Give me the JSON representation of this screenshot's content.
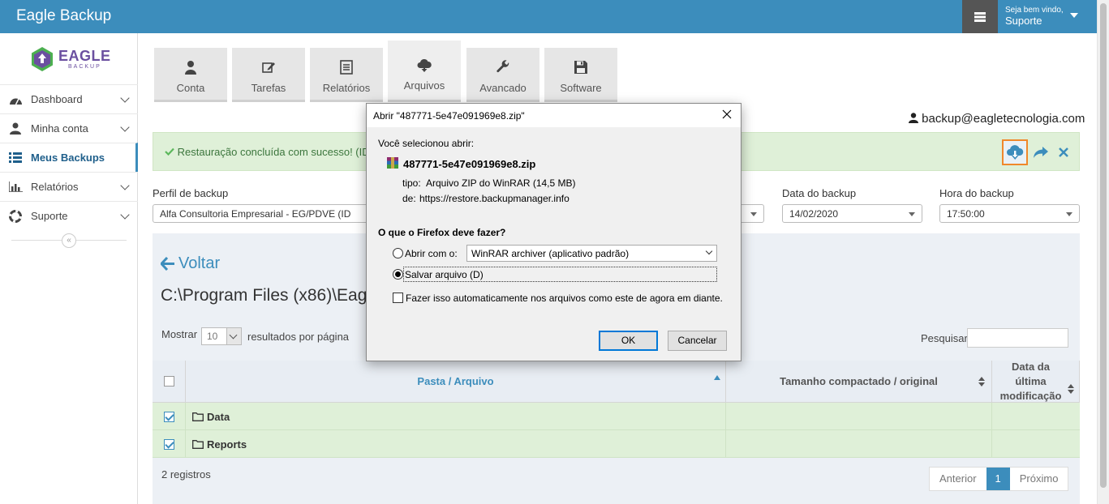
{
  "app": {
    "title": "Eagle Backup",
    "welcome": "Seja bem vindo,",
    "user_name": "Suporte"
  },
  "logo": {
    "text": "EAGLE",
    "sub": "BACKUP"
  },
  "sidebar": {
    "items": [
      {
        "label": "Dashboard",
        "icon": "dashboard-icon"
      },
      {
        "label": "Minha conta",
        "icon": "user-icon"
      },
      {
        "label": "Meus Backups",
        "icon": "list-icon",
        "active": true
      },
      {
        "label": "Relatórios",
        "icon": "bar-chart-icon"
      },
      {
        "label": "Suporte",
        "icon": "lifebuoy-icon"
      }
    ],
    "collapse_glyph": "«"
  },
  "tabs": [
    {
      "label": "Conta",
      "icon": "user-icon"
    },
    {
      "label": "Tarefas",
      "icon": "edit-icon"
    },
    {
      "label": "Relatórios",
      "icon": "report-icon"
    },
    {
      "label": "Arquivos",
      "icon": "cloud-download-icon",
      "active": true
    },
    {
      "label": "Avancado",
      "icon": "wrench-icon"
    },
    {
      "label": "Software",
      "icon": "floppy-icon"
    }
  ],
  "user_email": "backup@eagletecnologia.com",
  "alert": {
    "text": "Restauração concluída com sucesso! (ID",
    "color": "#3c763d"
  },
  "form": {
    "perfil_label": "Perfil de backup",
    "perfil_value": "Alfa Consultoria Empresarial - EG/PDVE (ID",
    "data_label": "Data do backup",
    "data_value": "14/02/2020",
    "hora_label": "Hora do backup",
    "hora_value": "17:50:00"
  },
  "content": {
    "back_label": "Voltar",
    "path": "C:\\Program Files (x86)\\Eagle",
    "show_label": "Mostrar",
    "page_size": "10",
    "show_suffix": "resultados por página",
    "search_label": "Pesquisar",
    "search_value": ""
  },
  "table": {
    "columns": [
      "Pasta / Arquivo",
      "Tamanho compactado / original",
      "Data da última modificação"
    ],
    "rows": [
      {
        "name": "Data",
        "checked": true,
        "size": "",
        "modified": ""
      },
      {
        "name": "Reports",
        "checked": true,
        "size": "",
        "modified": ""
      }
    ],
    "records": "2 registros"
  },
  "pager": {
    "prev": "Anterior",
    "current": "1",
    "next": "Próximo"
  },
  "dialog": {
    "title": "Abrir \"487771-5e47e091969e8.zip\"",
    "selected_label": "Você selecionou abrir:",
    "file_name": "487771-5e47e091969e8.zip",
    "type_label": "tipo:",
    "type_value": "Arquivo ZIP do WinRAR (14,5 MB)",
    "from_label": "de:",
    "from_value": "https://restore.backupmanager.info",
    "question": "O que o Firefox deve fazer?",
    "open_with_label": "Abrir com o:",
    "open_with_value": "WinRAR archiver (aplicativo padrão)",
    "save_label": "Salvar arquivo (D)",
    "auto_label": "Fazer isso automaticamente nos arquivos como este de agora em diante.",
    "ok": "OK",
    "cancel": "Cancelar"
  },
  "colors": {
    "topbar": "#3c8dbc",
    "accent": "#3c8dbc",
    "alert_bg": "#dff0d8",
    "highlight": "#f0882b"
  }
}
